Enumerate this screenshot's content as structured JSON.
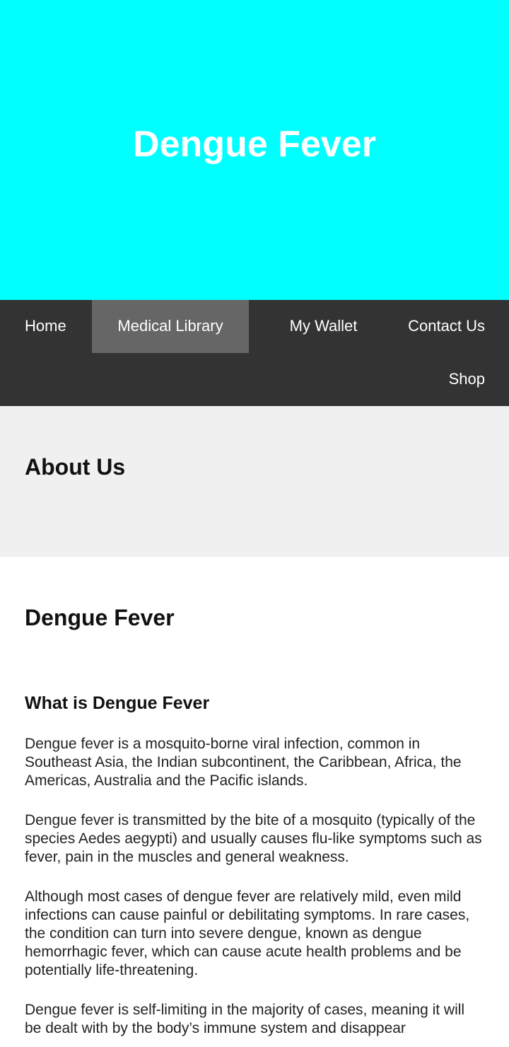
{
  "colors": {
    "hero_bg": "#00FFFF",
    "nav_bg": "#333333",
    "nav_active_bg": "#666666",
    "about_bg": "#F0F0F0",
    "white": "#FFFFFF"
  },
  "hero": {
    "title": "Dengue Fever"
  },
  "nav": {
    "home": "Home",
    "medical_library": "Medical Library",
    "my_wallet": "My Wallet",
    "contact_us": "Contact Us",
    "shop": "Shop",
    "active": "Medical Library"
  },
  "about": {
    "title": "About Us"
  },
  "article": {
    "title": "Dengue Fever",
    "heading": "What is Dengue Fever",
    "paragraphs": [
      "Dengue fever is a mosquito-borne viral infection, common in Southeast Asia, the Indian subcontinent, the Caribbean, Africa, the Americas, Australia and the Pacific islands.",
      "Dengue fever is transmitted by the bite of a mosquito (typically of the species Aedes aegypti) and usually causes flu-like symptoms such as fever, pain in the muscles and general weakness.",
      "Although most cases of dengue fever are relatively mild, even mild infections can cause painful or debilitating symptoms. In rare cases, the condition can turn into severe dengue, known as dengue hemorrhagic fever, which can cause acute health problems and be potentially life-threatening.",
      "Dengue fever is self-limiting in the majority of cases, meaning it will be dealt with by the body’s immune system and disappear"
    ]
  }
}
